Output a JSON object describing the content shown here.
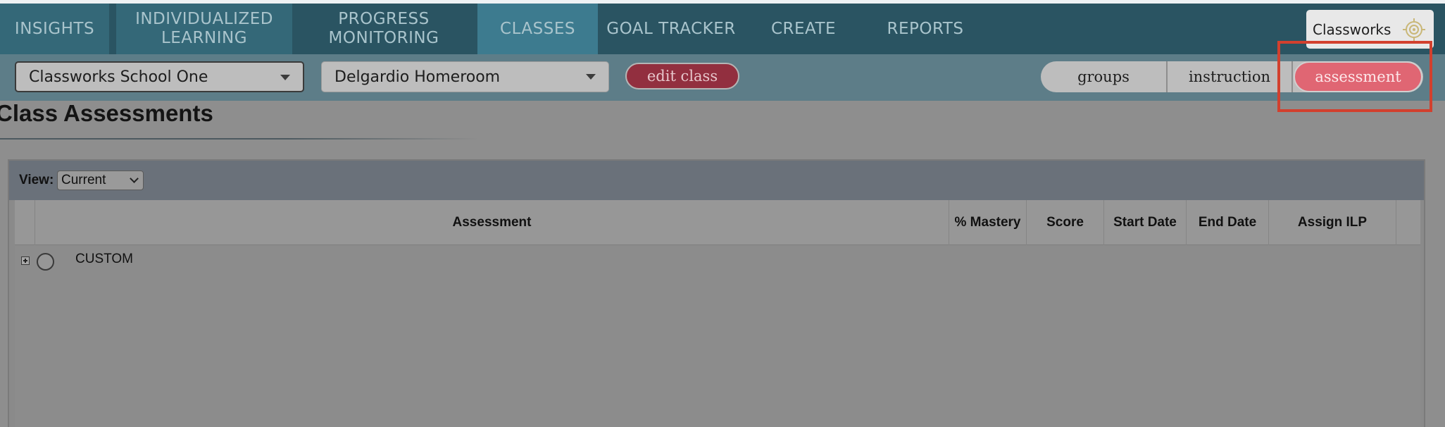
{
  "nav": {
    "items": [
      {
        "label": "INSIGHTS"
      },
      {
        "label": "INDIVIDUALIZED\nLEARNING"
      },
      {
        "label": "PROGRESS\nMONITORING"
      },
      {
        "label": "CLASSES"
      },
      {
        "label": "GOAL TRACKER"
      },
      {
        "label": "CREATE"
      },
      {
        "label": "REPORTS"
      }
    ],
    "brand": "Classworks"
  },
  "toolbar": {
    "school_select": "Classworks School One",
    "class_select": "Delgardio Homeroom",
    "edit_button": "edit class",
    "segments": {
      "groups": "groups",
      "instruction": "instruction",
      "assessment": "assessment"
    }
  },
  "page": {
    "title": "Class Assessments"
  },
  "panel": {
    "view_label": "View:",
    "view_value": "Current",
    "columns": [
      "Assessment",
      "% Mastery",
      "Score",
      "Start Date",
      "End Date",
      "Assign ILP"
    ],
    "rows": [
      {
        "label": "CUSTOM"
      }
    ]
  },
  "colors": {
    "nav_bg": "#2a5462",
    "active_segment": "#e06673",
    "highlight": "#d2402e"
  }
}
